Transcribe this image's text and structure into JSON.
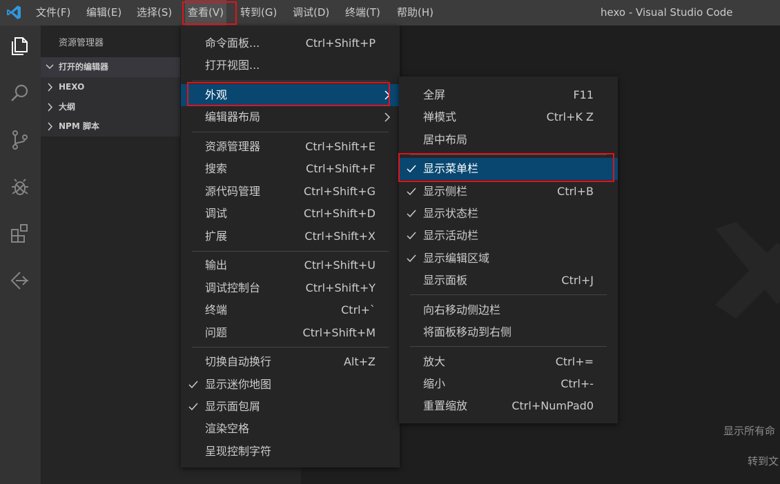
{
  "titlebar": {
    "menus": [
      "文件(F)",
      "编辑(E)",
      "选择(S)",
      "查看(V)",
      "转到(G)",
      "调试(D)",
      "终端(T)",
      "帮助(H)"
    ],
    "window_title": "hexo - Visual Studio Code"
  },
  "activitybar": {
    "icons": [
      "explorer-icon",
      "search-icon",
      "source-control-icon",
      "debug-icon",
      "extensions-icon",
      "remote-icon"
    ]
  },
  "sidebar": {
    "title": "资源管理器",
    "sections": [
      "打开的编辑器",
      "HEXO",
      "大纲",
      "NPM 脚本"
    ]
  },
  "view_menu": {
    "items": [
      {
        "label": "命令面板...",
        "key": "Ctrl+Shift+P"
      },
      {
        "label": "打开视图...",
        "key": ""
      },
      {
        "label": "外观",
        "key": ""
      },
      {
        "label": "编辑器布局",
        "key": ""
      },
      {
        "label": "资源管理器",
        "key": "Ctrl+Shift+E"
      },
      {
        "label": "搜索",
        "key": "Ctrl+Shift+F"
      },
      {
        "label": "源代码管理",
        "key": "Ctrl+Shift+G"
      },
      {
        "label": "调试",
        "key": "Ctrl+Shift+D"
      },
      {
        "label": "扩展",
        "key": "Ctrl+Shift+X"
      },
      {
        "label": "输出",
        "key": "Ctrl+Shift+U"
      },
      {
        "label": "调试控制台",
        "key": "Ctrl+Shift+Y"
      },
      {
        "label": "终端",
        "key": "Ctrl+`"
      },
      {
        "label": "问题",
        "key": "Ctrl+Shift+M"
      },
      {
        "label": "切换自动换行",
        "key": "Alt+Z"
      },
      {
        "label": "显示迷你地图",
        "key": ""
      },
      {
        "label": "显示面包屑",
        "key": ""
      },
      {
        "label": "渲染空格",
        "key": ""
      },
      {
        "label": "呈现控制字符",
        "key": ""
      }
    ]
  },
  "appearance_menu": {
    "items": [
      {
        "label": "全屏",
        "key": "F11"
      },
      {
        "label": "禅模式",
        "key": "Ctrl+K Z"
      },
      {
        "label": "居中布局",
        "key": ""
      },
      {
        "label": "显示菜单栏",
        "key": ""
      },
      {
        "label": "显示侧栏",
        "key": "Ctrl+B"
      },
      {
        "label": "显示状态栏",
        "key": ""
      },
      {
        "label": "显示活动栏",
        "key": ""
      },
      {
        "label": "显示编辑区域",
        "key": ""
      },
      {
        "label": "显示面板",
        "key": "Ctrl+J"
      },
      {
        "label": "向右移动侧边栏",
        "key": ""
      },
      {
        "label": "将面板移动到右侧",
        "key": ""
      },
      {
        "label": "放大",
        "key": "Ctrl+="
      },
      {
        "label": "缩小",
        "key": "Ctrl+-"
      },
      {
        "label": "重置缩放",
        "key": "Ctrl+NumPad0"
      }
    ]
  },
  "editor": {
    "hints": [
      "显示所有命",
      "转到文"
    ]
  },
  "colors": {
    "highlight": "#094771",
    "annotation_red": "#e0141a"
  }
}
